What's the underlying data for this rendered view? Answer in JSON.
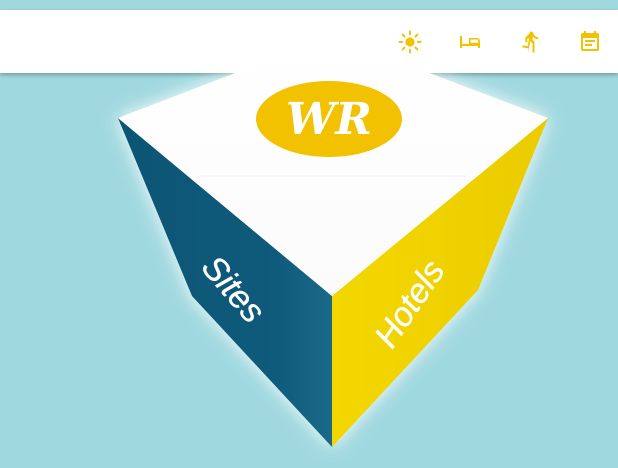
{
  "colors": {
    "background": "#a0d8df",
    "toolbar": "#ffffff",
    "accent_yellow": "#f2c200",
    "face_blue": "#0f5b7c",
    "face_yellow": "#efd300",
    "face_top": "#ffffff"
  },
  "toolbar": {
    "icons": [
      {
        "name": "sun-icon",
        "meaning": "weather"
      },
      {
        "name": "hotel-bed-icon",
        "meaning": "hotels"
      },
      {
        "name": "walking-icon",
        "meaning": "sites"
      },
      {
        "name": "calendar-icon",
        "meaning": "events"
      }
    ]
  },
  "cube": {
    "logo": {
      "text": "WR"
    },
    "left_face": {
      "label": "Sites"
    },
    "right_face": {
      "label": "Hotels"
    }
  }
}
